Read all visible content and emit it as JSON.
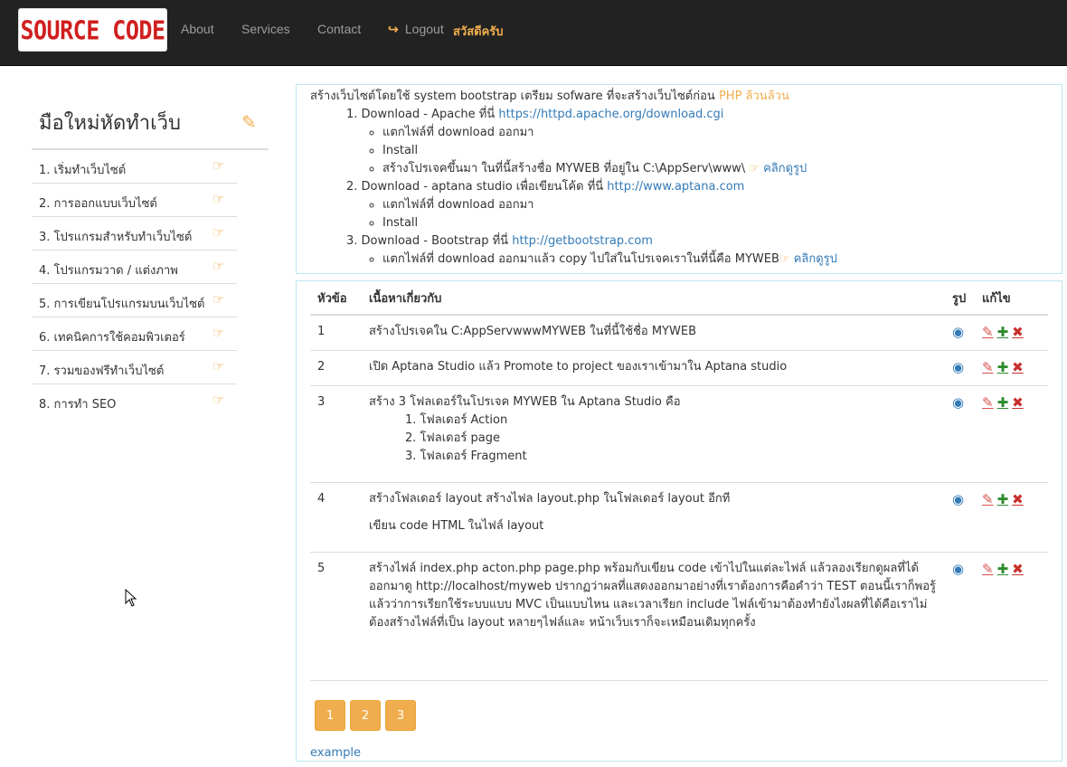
{
  "navbar": {
    "brand": "SOURCE CODE",
    "links": [
      "About",
      "Services",
      "Contact"
    ],
    "logout": "Logout",
    "greeting": "สวัสดีครับ",
    "icons": {
      "logout": "logout-icon"
    }
  },
  "sidebar": {
    "title": "มือใหม่หัดทำเว็บ",
    "items": [
      "1. เริ่มทำเว็บไซต์",
      "2. การออกแบบเว็บไซต์",
      "3. โปรแกรมสำหรับทำเว็บไซต์",
      "4. โปรแกรมวาด / แต่งภาพ",
      "5. การเขียนโปรแกรมบนเว็บไซต์",
      "6. เทคนิคการใช้คอมพิวเตอร์",
      "7. รวมของฟรีทำเว็บไซต์",
      "8. การทำ SEO"
    ]
  },
  "intro": {
    "lead": "สร้างเว็บไซต์โดยใช้ system bootstrap เตรียม sofware ที่จะสร้างเว็บไซต์ก่อน",
    "lead_highlight": "PHP ล้วนล้วน",
    "step1": "1. Download - Apache ที่นี่",
    "step1_link": "https://httpd.apache.org/download.cgi",
    "step1_bullets": [
      "แตกไฟล์ที่ download ออกมา",
      "Install",
      "สร้างโปรเจคขึ้นมา ในที่นี้สร้างชื่อ MYWEB ที่อยู่ใน C:\\AppServ\\www\\"
    ],
    "step2": "2. Download - aptana studio เพื่อเขียนโค้ด ที่นี่",
    "step2_link": "http://www.aptana.com",
    "step2_bullets": [
      "แตกไฟล์ที่ download ออกมา",
      "Install"
    ],
    "step3": "3. Download - Bootstrap ที่นี่",
    "step3_link": "http://getbootstrap.com",
    "step3_bullets": [
      "แตกไฟล์ที่ download ออกมาแล้ว copy ไปใส่ในโปรเจคเราในที่นี้คือ MYWEB"
    ],
    "click_pic": "คลิกดูรูป"
  },
  "table": {
    "headers": [
      "หัวข้อ",
      "เนื้อหาเกี่ยวกับ",
      "รูป",
      "แก้ไข"
    ],
    "rows": [
      {
        "no": "1",
        "text": "สร้างโปรเจคใน C:AppServwwwMYWEB ในที่นี้ใช้ชื่อ MYWEB"
      },
      {
        "no": "2",
        "text": "เปิด Aptana Studio แล้ว Promote to project ของเราเข้ามาใน Aptana studio"
      },
      {
        "no": "3",
        "text": "สร้าง 3 โฟลเดอร์ในโปรเจค MYWEB ใน Aptana Studio คือ",
        "sub": [
          "1. โฟลเดอร์ Action",
          "2. โฟลเดอร์ page",
          "3. โฟลเดอร์ Fragment"
        ]
      },
      {
        "no": "4",
        "text": "สร้างโฟลเดอร์ layout สร้างไฟล layout.php ในโฟลเดอร์ layout อีกที",
        "extra": "เขียน code HTML ในไฟล์ layout"
      },
      {
        "no": "5",
        "text": "สร้างไฟล์ index.php acton.php page.php พร้อมกับเขียน code เข้าไปในแต่ละไฟล์ แล้วลองเรียกดูผลที่ได้ออกมาดู http://localhost/myweb ปรากฏว่าผลที่แสดงออกมาอย่างที่เราต้องการคือคำว่า TEST ตอนนี้เราก็พอรู้แล้วว่าการเรียกใช้ระบบแบบ MVC เป็นแบบไหน และเวลาเรียก include ไฟล์เข้ามาต้องทำยังไงผลที่ได้คือเราไม่ต้องสร้างไฟล์ที่เป็น layout หลายๆไฟล์และ หน้าเว็บเราก็จะเหมือนเดิมทุกครั้ง"
      }
    ]
  },
  "pagination": [
    "1",
    "2",
    "3"
  ],
  "footer_link": "example",
  "colors": {
    "accent": "#f0ad4e",
    "link": "#337ab7",
    "brand": "#d01f1f",
    "navbar": "#222222"
  }
}
